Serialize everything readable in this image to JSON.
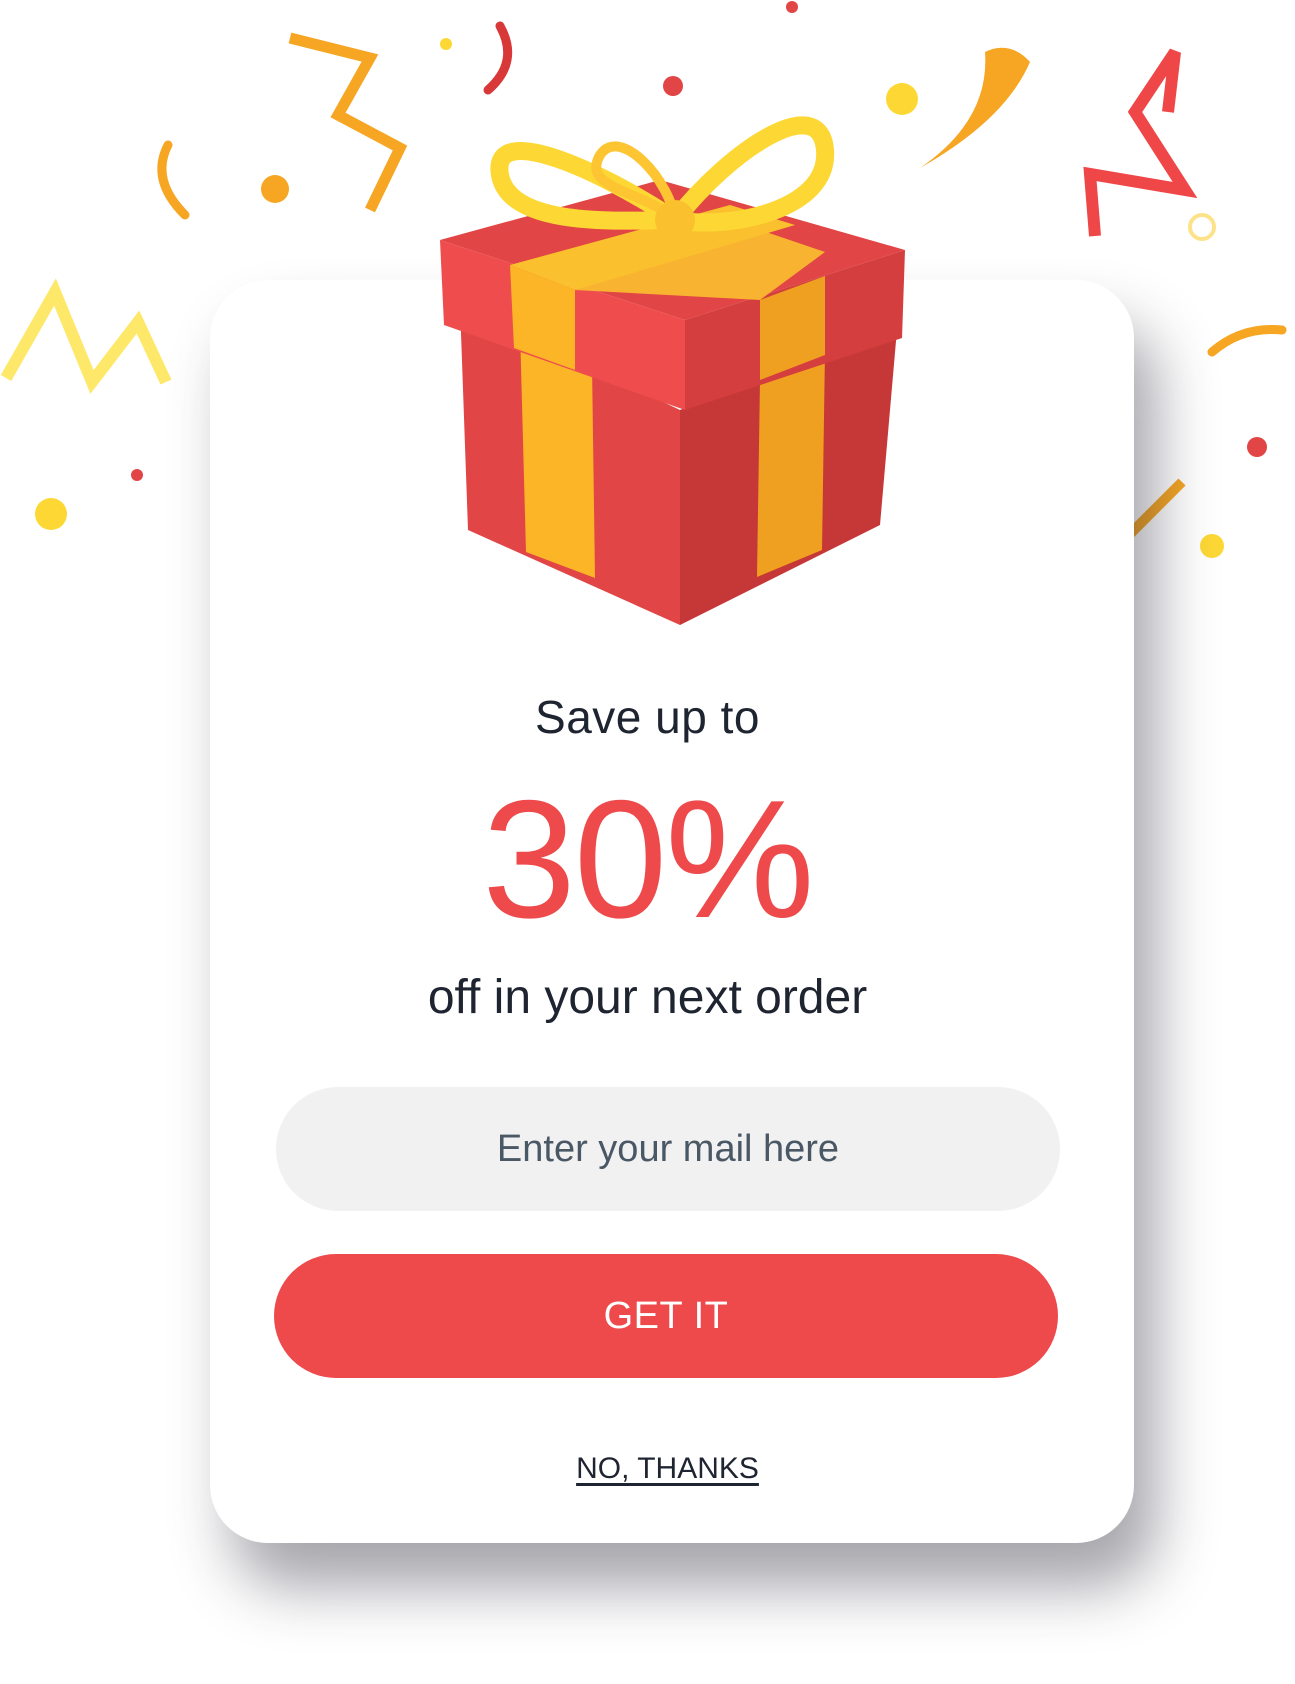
{
  "popup": {
    "headline": "Save up to",
    "discount": "30%",
    "subline": "off in your next order",
    "email_placeholder": "Enter your mail here",
    "email_value": "",
    "cta_label": "GET IT",
    "dismiss_label": "NO, THANKS"
  },
  "illustration": {
    "icon": "gift-box-icon",
    "decoration": "confetti"
  },
  "colors": {
    "accent": "#ee4a4b",
    "text_dark": "#1f2431",
    "input_bg": "#f1f1f1",
    "placeholder": "#4a5866",
    "ribbon": "#fbb526",
    "confetti_yellow": "#fdd835",
    "confetti_orange": "#f6a623",
    "confetti_red": "#e24545"
  }
}
